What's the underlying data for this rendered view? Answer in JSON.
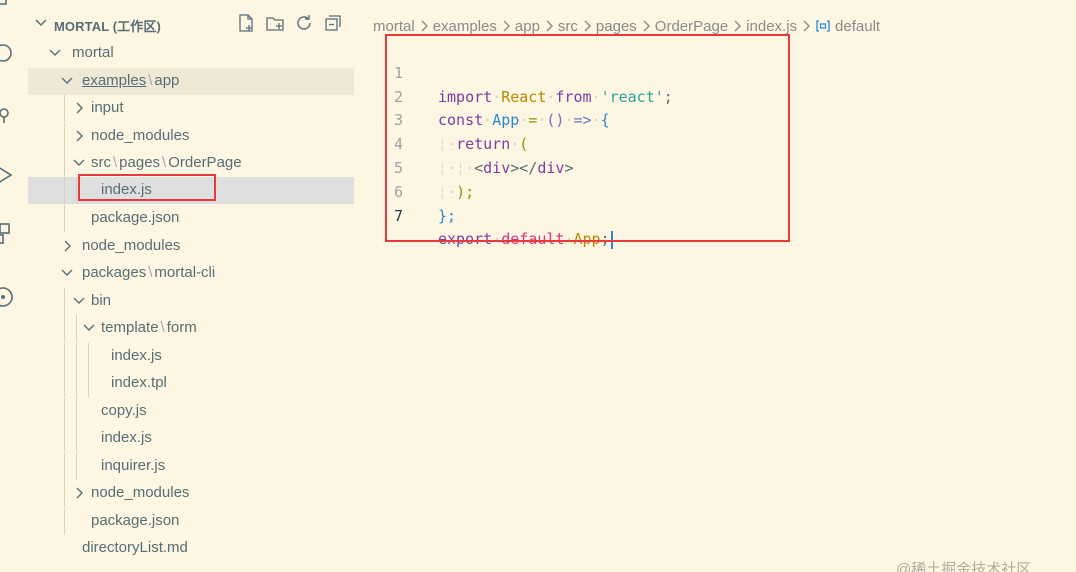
{
  "explorer": {
    "title": "MORTAL (工作区)",
    "tree": [
      {
        "label": "mortal"
      },
      {
        "parts": [
          "examples",
          "app"
        ]
      },
      {
        "label": "input"
      },
      {
        "label": "node_modules"
      },
      {
        "parts": [
          "src",
          "pages",
          "OrderPage"
        ]
      },
      {
        "label": "index.js"
      },
      {
        "label": "package.json"
      },
      {
        "label": "node_modules"
      },
      {
        "parts": [
          "packages",
          "mortal-cli"
        ]
      },
      {
        "label": "bin"
      },
      {
        "parts": [
          "template",
          "form"
        ]
      },
      {
        "label": "index.js"
      },
      {
        "label": "index.tpl"
      },
      {
        "label": "copy.js"
      },
      {
        "label": "index.js"
      },
      {
        "label": "inquirer.js"
      },
      {
        "label": "node_modules"
      },
      {
        "label": "package.json"
      },
      {
        "label": "directoryList.md"
      }
    ]
  },
  "breadcrumb": [
    "mortal",
    "examples",
    "app",
    "src",
    "pages",
    "OrderPage",
    "index.js",
    "default"
  ],
  "editor": {
    "line_numbers": [
      "1",
      "2",
      "3",
      "4",
      "5",
      "6",
      "7"
    ],
    "active_line": "7",
    "tokens": {
      "l1_import": "import",
      "l1_react": "React",
      "l1_from": "from",
      "l1_str": "'react'",
      "l1_semi": ";",
      "l2_const": "const",
      "l2_app": "App",
      "l2_eq": "=",
      "l2_parens": "()",
      "l2_arrow": "=>",
      "l2_brace": "{",
      "l3_return": "return",
      "l3_paren": "(",
      "l4_open": "<",
      "l4_div": "div",
      "l4_mid": "></",
      "l4_div2": "div",
      "l4_close": ">",
      "l5_close": ");",
      "l6_close": "};",
      "l7_export": "export",
      "l7_default": "default",
      "l7_app": "App",
      "l7_semi": ";"
    }
  },
  "watermark": "@稀土掘金技术社区",
  "colors": {
    "background": "#fdf6e3",
    "selected_row": "#dfdfdf",
    "hover_row": "#eee8d5",
    "annotation_box": "#e83a3a"
  }
}
